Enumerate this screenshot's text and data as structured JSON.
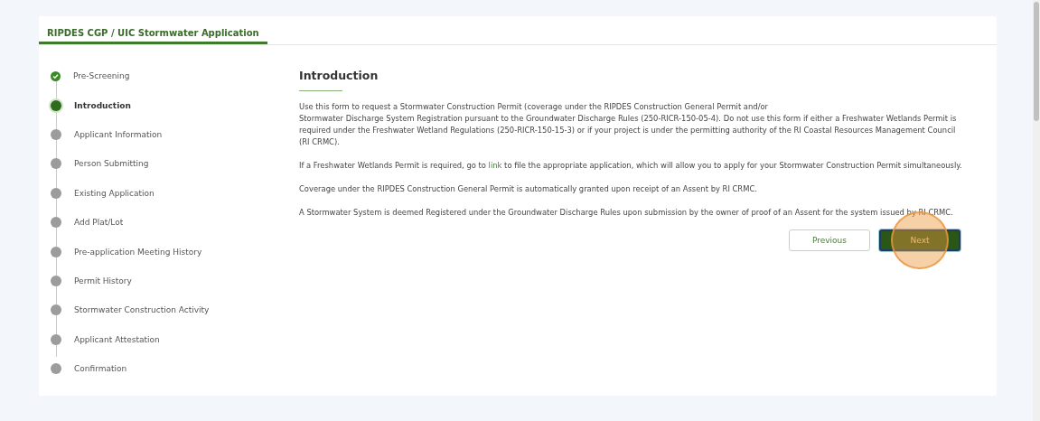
{
  "tab": {
    "label": "RIPDES CGP / UIC Stormwater Application",
    "selected": true
  },
  "steps": [
    {
      "label": "Pre-Screening",
      "completed": true,
      "selected": false
    },
    {
      "label": "Introduction",
      "completed": false,
      "selected": true
    },
    {
      "label": "Applicant Information",
      "completed": false,
      "selected": false
    },
    {
      "label": "Person Submitting",
      "completed": false,
      "selected": false
    },
    {
      "label": "Existing Application",
      "completed": false,
      "selected": false
    },
    {
      "label": "Add Plat/Lot",
      "completed": false,
      "selected": false
    },
    {
      "label": "Pre-application Meeting History",
      "completed": false,
      "selected": false
    },
    {
      "label": "Permit History",
      "completed": false,
      "selected": false
    },
    {
      "label": "Stormwater Construction Activity",
      "completed": false,
      "selected": false
    },
    {
      "label": "Applicant Attestation",
      "completed": false,
      "selected": false
    },
    {
      "label": "Confirmation",
      "completed": false,
      "selected": false
    }
  ],
  "heading": "Introduction",
  "paragraphs": [
    [
      {
        "kind": "text",
        "text": "Use this form to request a Stormwater Construction Permit (coverage under the RIPDES Construction General Permit and/or\nStormwater Discharge System Registration pursuant to the Groundwater Discharge Rules (250-RICR-150-05-4). Do not use this form if either a Freshwater Wetlands Permit is required under the Freshwater Wetland Regulations (250-RICR-150-15-3) or if your project is under the permitting authority of the RI Coastal Resources Management Council (RI CRMC)."
      }
    ],
    [
      {
        "kind": "text",
        "text": "If a Freshwater Wetlands Permit is required, go to"
      },
      {
        "kind": "link",
        "text": "link"
      },
      {
        "kind": "text",
        "text": "to file the appropriate application, which will allow you to apply for your Stormwater Construction Permit simultaneously."
      }
    ],
    [
      {
        "kind": "text",
        "text": "Coverage under the RIPDES Construction General Permit is automatically granted upon receipt of an Assent by RI CRMC."
      }
    ],
    [
      {
        "kind": "text",
        "text": "A Stormwater System is deemed Registered under the Groundwater Discharge Rules upon submission by the owner of proof of an Assent for the system issued by RI CRMC."
      }
    ]
  ],
  "buttons": [
    {
      "label": "Previous",
      "kind": "secondary",
      "highlighted": false
    },
    {
      "label": "Next",
      "kind": "primary",
      "highlighted": true
    }
  ]
}
